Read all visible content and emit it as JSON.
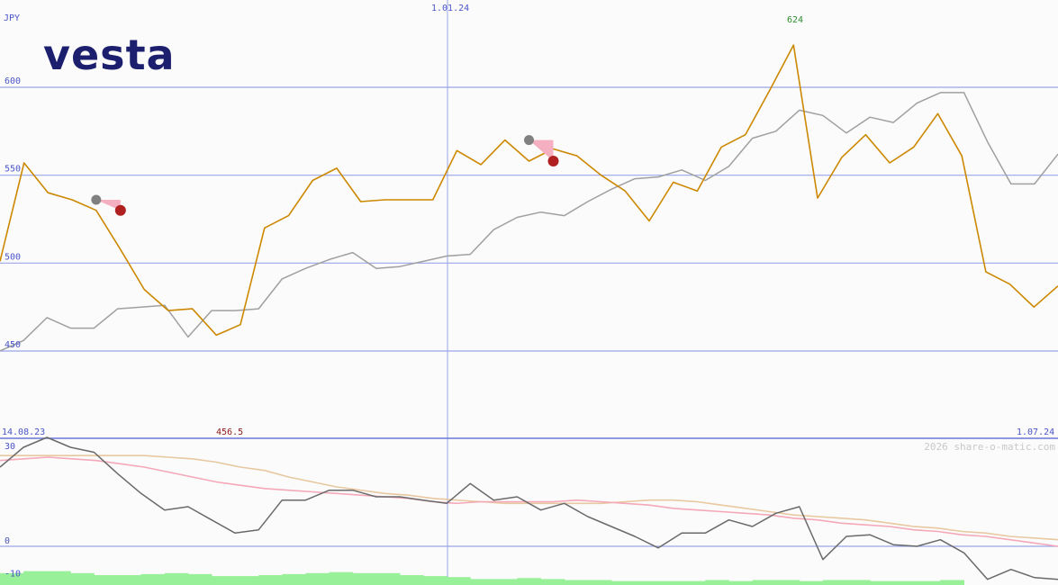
{
  "brand": {
    "logo": "vesta",
    "color": "#1b1f6e"
  },
  "chart_data": [
    {
      "type": "line",
      "currency_label": "JPY",
      "ylim": [
        425,
        650
      ],
      "yticks": [
        450,
        500,
        550,
        600
      ],
      "ytick_labels": [
        "450",
        "500",
        "550",
        "600"
      ],
      "x_start_label": "14.08.23",
      "x_mid_label": "1.01.24",
      "x_end_label": "1.07.24",
      "high_label": "624",
      "low_label": "456.5",
      "series": [
        {
          "color": "#cc8800",
          "values": [
            501,
            557,
            540,
            536,
            530,
            508,
            485,
            473,
            474,
            459,
            465,
            520,
            527,
            547,
            554,
            535,
            536,
            536,
            536,
            564,
            556,
            570,
            558,
            565,
            561,
            550,
            541,
            524,
            546,
            541,
            566,
            573,
            598,
            624,
            537,
            560,
            573,
            557,
            566,
            585,
            561,
            495,
            488,
            475,
            487
          ]
        },
        {
          "color": "#a0a0a0",
          "values": [
            450,
            456,
            469,
            463,
            463,
            474,
            475,
            476,
            458,
            473,
            473,
            474,
            491,
            497,
            502,
            506,
            497,
            498,
            501,
            504,
            505,
            519,
            526,
            529,
            527,
            535,
            542,
            548,
            549,
            553,
            547,
            555,
            571,
            575,
            587,
            584,
            574,
            583,
            580,
            591,
            597,
            597,
            569,
            545,
            545,
            562
          ]
        }
      ],
      "signals": [
        {
          "kind": "sell",
          "index": 4,
          "marker_value": 536,
          "signal_value": 530
        },
        {
          "kind": "sell",
          "index": 22,
          "marker_value": 570,
          "signal_value": 558
        }
      ]
    },
    {
      "type": "line",
      "ylim": [
        -13,
        34
      ],
      "yticks": [
        30,
        0,
        -10
      ],
      "ytick_labels": [
        "30",
        "0",
        "-10"
      ],
      "series": [
        {
          "color": "#6a6a6a",
          "values": [
            24,
            30,
            33,
            30,
            28.5,
            22,
            16,
            11,
            12,
            8,
            4,
            5,
            14,
            14,
            17,
            17,
            15,
            15,
            14,
            13,
            19,
            14,
            15,
            11,
            13,
            9,
            6,
            3,
            -0.5,
            4,
            4,
            8,
            6,
            10,
            12,
            -4,
            3,
            3.5,
            0.5,
            0,
            2,
            -2,
            -10,
            -7,
            -9.5,
            -10
          ]
        },
        {
          "color": "#f4a8b8",
          "values": [
            26,
            26.5,
            27,
            26.5,
            26,
            25,
            24,
            22.5,
            21,
            19.5,
            18.5,
            17.5,
            17,
            16.5,
            16,
            15.5,
            15,
            14.5,
            13.5,
            13,
            13.5,
            13.5,
            13.5,
            13.5,
            14,
            13.5,
            13,
            12.5,
            11.5,
            11,
            10.5,
            10,
            9.5,
            8.5,
            8,
            7,
            6.5,
            6,
            5,
            4.5,
            3.5,
            3,
            2,
            1,
            0
          ]
        },
        {
          "color": "#e8c8a0",
          "values": [
            27.5,
            27.5,
            27.5,
            27.5,
            27.5,
            27.5,
            27.5,
            27,
            26.5,
            25.5,
            24,
            23,
            21,
            19.5,
            18,
            17,
            16,
            15.5,
            14.5,
            14,
            13.5,
            13,
            13,
            13,
            13,
            13,
            13.5,
            14,
            14,
            13.5,
            12.5,
            11.5,
            10.5,
            9.5,
            9,
            8.5,
            8,
            7,
            6,
            5.5,
            4.5,
            4,
            3,
            2.5,
            2
          ]
        }
      ],
      "volume": {
        "color": "#98f098",
        "values": [
          6,
          7,
          7,
          6,
          5,
          5,
          5.5,
          6,
          5.5,
          4.5,
          4.5,
          5,
          5.5,
          6,
          6.5,
          6,
          6,
          5,
          4.5,
          4,
          3,
          3,
          3.5,
          3,
          2.5,
          2.5,
          2,
          2,
          2,
          2,
          2.5,
          2,
          2.5,
          2.5,
          2,
          2.5,
          2.5,
          2,
          2,
          2,
          2.5,
          0,
          0,
          0,
          0
        ]
      }
    }
  ],
  "copyright": "2026 share-o-matic.com"
}
